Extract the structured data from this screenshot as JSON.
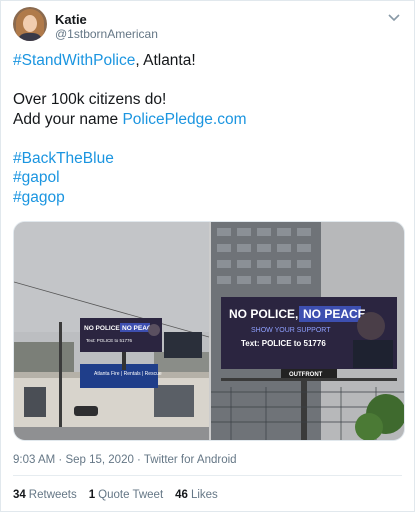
{
  "author": {
    "name": "Katie",
    "handle": "@1stbornAmerican"
  },
  "tweet": {
    "line1_hashtag": "#StandWithPolice",
    "line1_rest": ", Atlanta!",
    "line2": "Over 100k citizens do!",
    "line3_prefix": "Add your name ",
    "line3_link": "PolicePledge.com",
    "hashtags": [
      "#BackTheBlue",
      "#gapol",
      "#gagop"
    ]
  },
  "media": {
    "left_billboard_title": "NO POLICE,",
    "left_billboard_title2": "NO PEACE.",
    "left_billboard_sub": "Text: POLICE to 51776",
    "left_sign_lower": "Atlanta Fire | Rentals | Rescue",
    "right_billboard_title": "NO POLICE,",
    "right_billboard_title2": "NO PEACE.",
    "right_billboard_tag": "SHOW YOUR SUPPORT",
    "right_billboard_sub": "Text: POLICE to 51776",
    "right_billboard_vendor": "OUTFRONT"
  },
  "meta": {
    "time": "9:03 AM",
    "sep": " · ",
    "date": "Sep 15, 2020",
    "source": "Twitter for Android"
  },
  "stats": {
    "retweets_count": "34",
    "retweets_label": "Retweets",
    "quotes_count": "1",
    "quotes_label": "Quote Tweet",
    "likes_count": "46",
    "likes_label": "Likes"
  },
  "colors": {
    "link": "#1b95e0",
    "secondary_text": "#657786",
    "billboard_bg": "#2b2540",
    "billboard_accent": "#3d4fb0"
  },
  "icons": [
    "chevron-down-icon"
  ]
}
